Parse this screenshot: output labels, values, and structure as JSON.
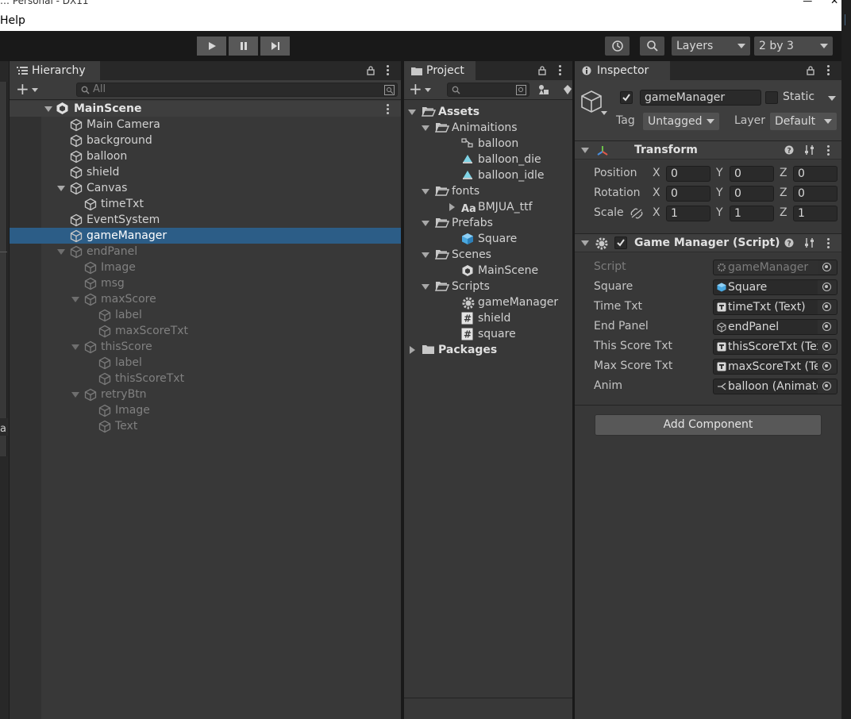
{
  "window": {
    "title": "… Personal - DX11",
    "menu": [
      "Help"
    ]
  },
  "toolbar": {
    "layers_label": "Layers",
    "layout_label": "2 by 3"
  },
  "hierarchy": {
    "tab_label": "Hierarchy",
    "search_placeholder": "All",
    "scene": "MainScene",
    "items": [
      {
        "label": "Main Camera",
        "depth": 1,
        "active": true
      },
      {
        "label": "background",
        "depth": 1,
        "active": true
      },
      {
        "label": "balloon",
        "depth": 1,
        "active": true
      },
      {
        "label": "shield",
        "depth": 1,
        "active": true
      },
      {
        "label": "Canvas",
        "depth": 1,
        "active": true,
        "expanded": true
      },
      {
        "label": "timeTxt",
        "depth": 2,
        "active": true
      },
      {
        "label": "EventSystem",
        "depth": 1,
        "active": true
      },
      {
        "label": "gameManager",
        "depth": 1,
        "active": true,
        "selected": true
      },
      {
        "label": "endPanel",
        "depth": 1,
        "active": false,
        "expanded": true
      },
      {
        "label": "Image",
        "depth": 2,
        "active": false
      },
      {
        "label": "msg",
        "depth": 2,
        "active": false
      },
      {
        "label": "maxScore",
        "depth": 2,
        "active": false,
        "expanded": true
      },
      {
        "label": "label",
        "depth": 3,
        "active": false
      },
      {
        "label": "maxScoreTxt",
        "depth": 3,
        "active": false
      },
      {
        "label": "thisScore",
        "depth": 2,
        "active": false,
        "expanded": true
      },
      {
        "label": "label",
        "depth": 3,
        "active": false
      },
      {
        "label": "thisScoreTxt",
        "depth": 3,
        "active": false
      },
      {
        "label": "retryBtn",
        "depth": 2,
        "active": false,
        "expanded": true
      },
      {
        "label": "Image",
        "depth": 3,
        "active": false
      },
      {
        "label": "Text",
        "depth": 3,
        "active": false
      }
    ]
  },
  "project": {
    "tab_label": "Project",
    "tree": [
      {
        "label": "Assets",
        "depth": 0,
        "icon": "folder-open-icon",
        "bold": true,
        "arrow": "down"
      },
      {
        "label": "Animaitions",
        "depth": 1,
        "icon": "folder-open-icon",
        "arrow": "down"
      },
      {
        "label": "balloon",
        "depth": 2,
        "icon": "animator-icon"
      },
      {
        "label": "balloon_die",
        "depth": 2,
        "icon": "anim-clip-icon"
      },
      {
        "label": "balloon_idle",
        "depth": 2,
        "icon": "anim-clip-icon"
      },
      {
        "label": "fonts",
        "depth": 1,
        "icon": "folder-open-icon",
        "arrow": "down"
      },
      {
        "label": "BMJUA_ttf",
        "depth": 2,
        "icon": "font-icon",
        "arrow": "right"
      },
      {
        "label": "Prefabs",
        "depth": 1,
        "icon": "folder-open-icon",
        "arrow": "down"
      },
      {
        "label": "Square",
        "depth": 2,
        "icon": "prefab-icon"
      },
      {
        "label": "Scenes",
        "depth": 1,
        "icon": "folder-open-icon",
        "arrow": "down"
      },
      {
        "label": "MainScene",
        "depth": 2,
        "icon": "scene-icon"
      },
      {
        "label": "Scripts",
        "depth": 1,
        "icon": "folder-open-icon",
        "arrow": "down"
      },
      {
        "label": "gameManager",
        "depth": 2,
        "icon": "gear-script-icon"
      },
      {
        "label": "shield",
        "depth": 2,
        "icon": "cs-script-icon"
      },
      {
        "label": "square",
        "depth": 2,
        "icon": "cs-script-icon"
      },
      {
        "label": "Packages",
        "depth": 0,
        "icon": "folder-closed-icon",
        "bold": true,
        "arrow": "right"
      }
    ]
  },
  "inspector": {
    "tab_label": "Inspector",
    "object_name": "gameManager",
    "static_label": "Static",
    "tag_label": "Tag",
    "tag_value": "Untagged",
    "layer_label": "Layer",
    "layer_value": "Default",
    "transform": {
      "title": "Transform",
      "rows": [
        {
          "label": "Position",
          "x": "0",
          "y": "0",
          "z": "0"
        },
        {
          "label": "Rotation",
          "x": "0",
          "y": "0",
          "z": "0"
        },
        {
          "label": "Scale",
          "x": "1",
          "y": "1",
          "z": "1"
        }
      ],
      "axis": {
        "x": "X",
        "y": "Y",
        "z": "Z"
      }
    },
    "script_component": {
      "title": "Game Manager (Script)",
      "fields": [
        {
          "label": "Script",
          "value": "gameManager",
          "icon": "script-icon",
          "disabled": true
        },
        {
          "label": "Square",
          "value": "Square",
          "icon": "prefab-icon"
        },
        {
          "label": "Time Txt",
          "value": "timeTxt (Text)",
          "icon": "text-icon"
        },
        {
          "label": "End Panel",
          "value": "endPanel",
          "icon": "gameobject-icon"
        },
        {
          "label": "This Score Txt",
          "value": "thisScoreTxt (Text)",
          "icon": "text-icon"
        },
        {
          "label": "Max Score Txt",
          "value": "maxScoreTxt (Text)",
          "icon": "text-icon"
        },
        {
          "label": "Anim",
          "value": "balloon (Animator)",
          "icon": "animator-icon"
        }
      ]
    },
    "add_component": "Add Component"
  },
  "left_strip": {
    "letter": "a"
  },
  "colors": {
    "selection": "#2c5d87",
    "panel": "#383838",
    "tabbar": "#282828"
  }
}
